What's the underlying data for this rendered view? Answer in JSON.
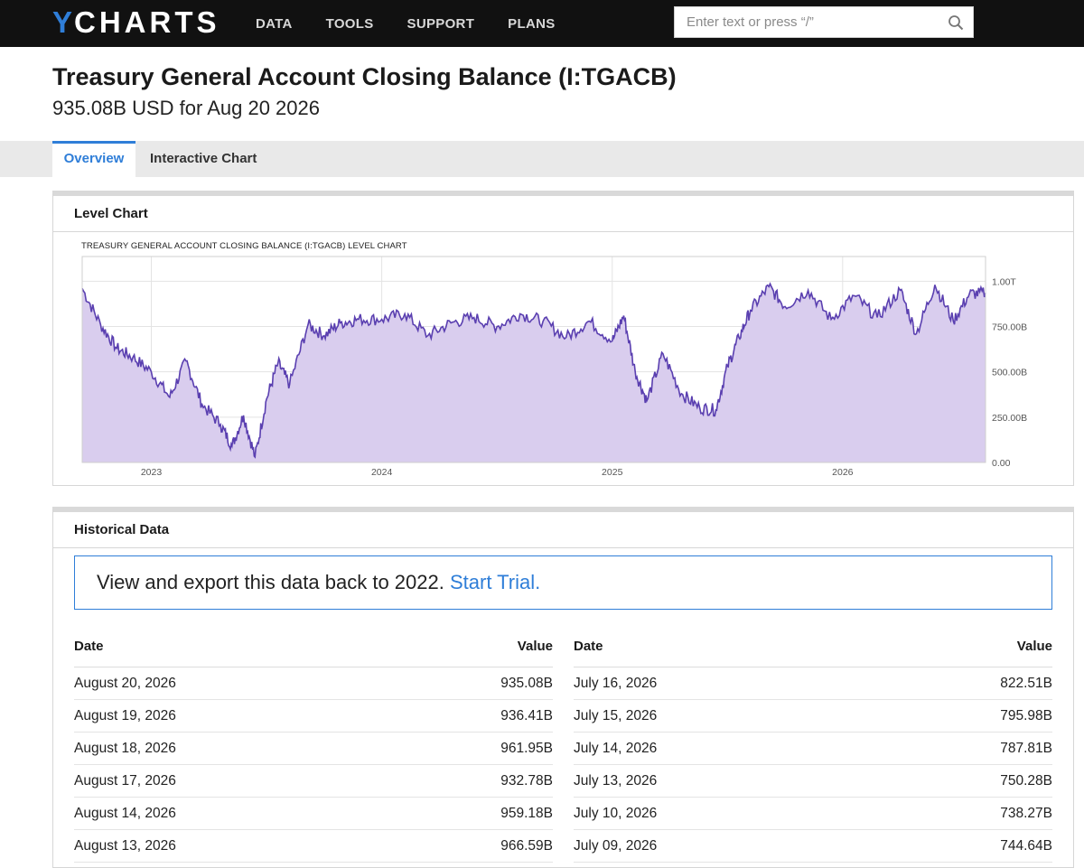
{
  "nav": {
    "logo_y": "Y",
    "logo_rest": "CHARTS",
    "links": [
      "DATA",
      "TOOLS",
      "SUPPORT",
      "PLANS"
    ],
    "search_placeholder": "Enter text or press “/”"
  },
  "header": {
    "title": "Treasury General Account Closing Balance (I:TGACB)",
    "subtitle": "935.08B USD for Aug 20 2026"
  },
  "tabs": [
    {
      "label": "Overview",
      "active": true
    },
    {
      "label": "Interactive Chart",
      "active": false
    }
  ],
  "level_chart": {
    "panel_title": "Level Chart",
    "caption": "TREASURY GENERAL ACCOUNT CLOSING BALANCE (I:TGACB) LEVEL CHART"
  },
  "chart_data": {
    "type": "area",
    "title": "TREASURY GENERAL ACCOUNT CLOSING BALANCE (I:TGACB) LEVEL CHART",
    "x_tick_labels": [
      "2023",
      "2024",
      "2025",
      "2026"
    ],
    "y_tick_labels": [
      "1.00T",
      "750.00B",
      "500.00B",
      "250.00B",
      "0.00"
    ],
    "ylim": [
      0,
      1000
    ],
    "y_units": "B USD",
    "grid": true,
    "colors": {
      "line": "#5a3fb0",
      "fill": "#d9cdee"
    },
    "series": [
      {
        "x": [
          2022.7,
          2022.78,
          2022.85,
          2022.92,
          2023.0,
          2023.08,
          2023.15,
          2023.22,
          2023.3,
          2023.35,
          2023.4,
          2023.45,
          2023.5,
          2023.55,
          2023.6,
          2023.68,
          2023.75,
          2023.82,
          2023.9,
          2024.0,
          2024.1,
          2024.2,
          2024.3,
          2024.4,
          2024.5,
          2024.6,
          2024.7,
          2024.8,
          2024.9,
          2025.0,
          2025.05,
          2025.1,
          2025.15,
          2025.22,
          2025.3,
          2025.38,
          2025.45,
          2025.5,
          2025.55,
          2025.6,
          2025.68,
          2025.75,
          2025.85,
          2025.95,
          2026.05,
          2026.15,
          2026.25,
          2026.32,
          2026.4,
          2026.48,
          2026.55,
          2026.62
        ],
        "values": [
          960,
          760,
          630,
          580,
          500,
          360,
          560,
          320,
          210,
          90,
          260,
          30,
          350,
          550,
          430,
          760,
          700,
          770,
          790,
          790,
          820,
          700,
          770,
          800,
          750,
          820,
          780,
          690,
          780,
          670,
          810,
          500,
          340,
          600,
          380,
          300,
          290,
          530,
          690,
          840,
          970,
          860,
          950,
          790,
          920,
          800,
          950,
          710,
          980,
          780,
          930,
          935.08
        ]
      }
    ]
  },
  "historical": {
    "panel_title": "Historical Data",
    "trial_text": "View and export this data back to 2022.",
    "trial_link": "Start Trial.",
    "columns": {
      "date": "Date",
      "value": "Value"
    },
    "left_rows": [
      {
        "date": "August 20, 2026",
        "value": "935.08B"
      },
      {
        "date": "August 19, 2026",
        "value": "936.41B"
      },
      {
        "date": "August 18, 2026",
        "value": "961.95B"
      },
      {
        "date": "August 17, 2026",
        "value": "932.78B"
      },
      {
        "date": "August 14, 2026",
        "value": "959.18B"
      },
      {
        "date": "August 13, 2026",
        "value": "966.59B"
      }
    ],
    "right_rows": [
      {
        "date": "July 16, 2026",
        "value": "822.51B"
      },
      {
        "date": "July 15, 2026",
        "value": "795.98B"
      },
      {
        "date": "July 14, 2026",
        "value": "787.81B"
      },
      {
        "date": "July 13, 2026",
        "value": "750.28B"
      },
      {
        "date": "July 10, 2026",
        "value": "738.27B"
      },
      {
        "date": "July 09, 2026",
        "value": "744.64B"
      }
    ]
  }
}
